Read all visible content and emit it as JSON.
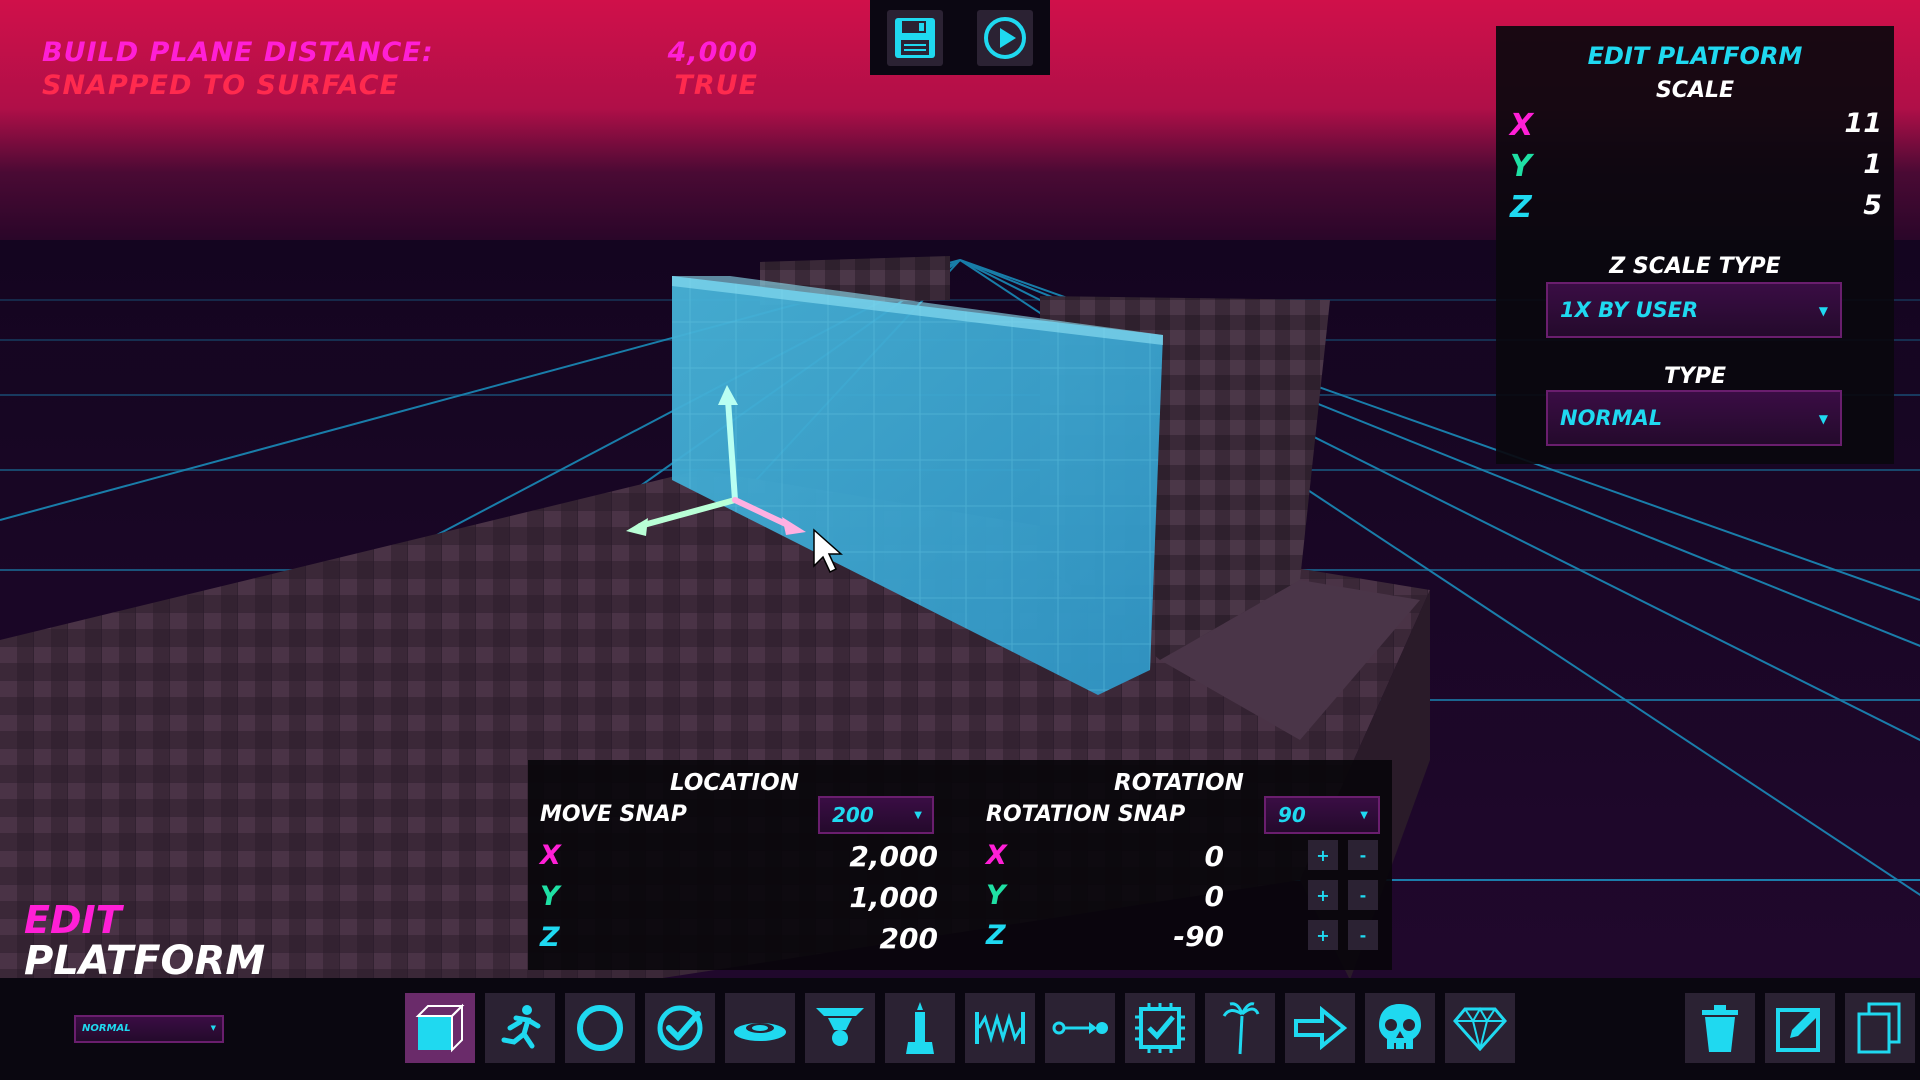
{
  "hud": {
    "build_plane_label": "BUILD PLANE DISTANCE:",
    "build_plane_value": "4,000",
    "snapped_label": "SNAPPED TO SURFACE",
    "snapped_value": "TRUE"
  },
  "top_toolbar": {
    "save_icon": "save-icon",
    "play_icon": "play-icon"
  },
  "edit_panel": {
    "title": "EDIT PLATFORM",
    "scale_label": "SCALE",
    "scale": {
      "x_label": "X",
      "x": "11",
      "y_label": "Y",
      "y": "1",
      "z_label": "Z",
      "z": "5"
    },
    "z_scale_type_label": "Z SCALE TYPE",
    "z_scale_type_value": "1X BY USER",
    "type_label": "TYPE",
    "type_value": "NORMAL"
  },
  "mode": {
    "line1": "EDIT",
    "line2": "PLATFORM"
  },
  "location": {
    "title": "LOCATION",
    "snap_label": "MOVE SNAP",
    "snap_value": "200",
    "x_label": "X",
    "x": "2,000",
    "y_label": "Y",
    "y": "1,000",
    "z_label": "Z",
    "z": "200"
  },
  "rotation": {
    "title": "ROTATION",
    "snap_label": "ROTATION SNAP",
    "snap_value": "90",
    "x_label": "X",
    "x": "0",
    "y_label": "Y",
    "y": "0",
    "z_label": "Z",
    "z": "-90",
    "plus": "+",
    "minus": "-"
  },
  "bottom_bar": {
    "mini_dropdown_value": "NORMAL",
    "tools": [
      "cube-icon",
      "runner-icon",
      "ring-icon",
      "checkmark-icon",
      "pad-icon",
      "lamp-icon",
      "statue-icon",
      "spring-icon",
      "path-icon",
      "checkpoint-chip-icon",
      "palm-tree-icon",
      "arrow-right-icon",
      "skull-icon",
      "diamond-icon"
    ],
    "actions": [
      "trash-icon",
      "edit-icon",
      "copy-icon"
    ]
  },
  "colors": {
    "x_axis": "#ff1fd6",
    "y_axis": "#1fe0a4",
    "z_axis": "#1fd9f0",
    "sky": "#c8104a"
  }
}
